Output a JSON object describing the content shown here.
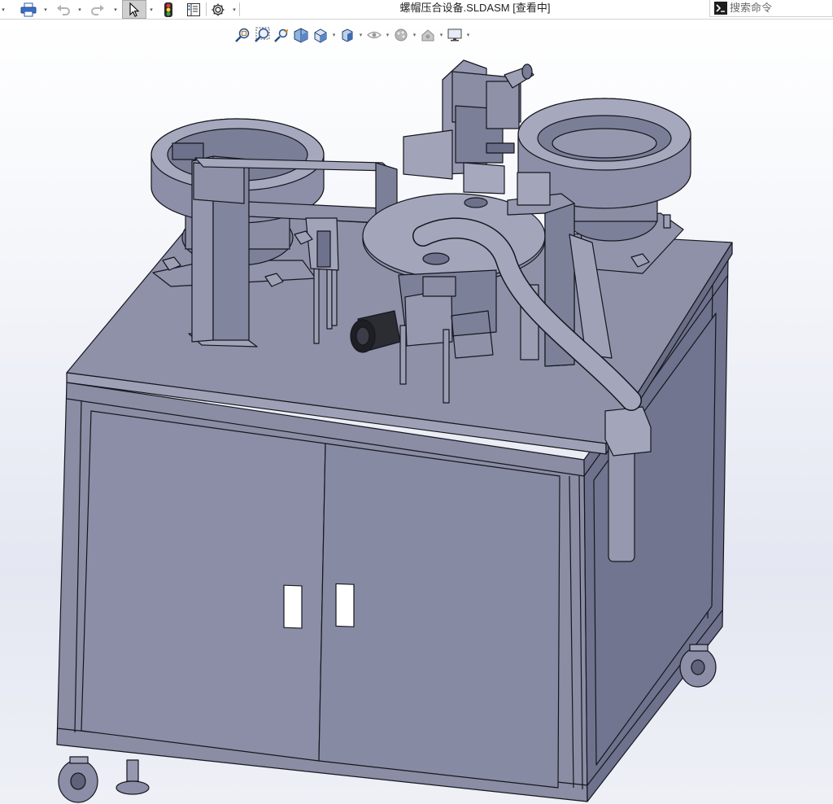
{
  "titlebar": {
    "document_title": "螺帽压合设备.SLDASM [查看中]",
    "search": {
      "placeholder": "搜索命令",
      "value": ""
    },
    "tools": [
      {
        "name": "print-icon"
      },
      {
        "name": "undo-icon"
      },
      {
        "name": "redo-icon"
      },
      {
        "name": "select-pointer-icon"
      },
      {
        "name": "rebuild-traffic-light-icon"
      },
      {
        "name": "file-properties-icon"
      },
      {
        "name": "options-gear-icon"
      }
    ]
  },
  "heads_up_toolbar": {
    "tools": [
      {
        "name": "zoom-to-fit-icon"
      },
      {
        "name": "zoom-to-area-icon"
      },
      {
        "name": "previous-view-icon"
      },
      {
        "name": "section-view-icon"
      },
      {
        "name": "view-orientation-icon"
      },
      {
        "name": "display-style-icon"
      },
      {
        "name": "hide-show-items-icon"
      },
      {
        "name": "edit-appearance-icon"
      },
      {
        "name": "apply-scene-icon"
      },
      {
        "name": "view-settings-icon"
      }
    ]
  },
  "colors": {
    "model_fill": "#8b8ea6",
    "model_light": "#a9abbf",
    "model_dark": "#5e6179",
    "edge": "#16161e",
    "viewport_top": "#ffffff",
    "viewport_bottom": "#e4e7f1"
  }
}
